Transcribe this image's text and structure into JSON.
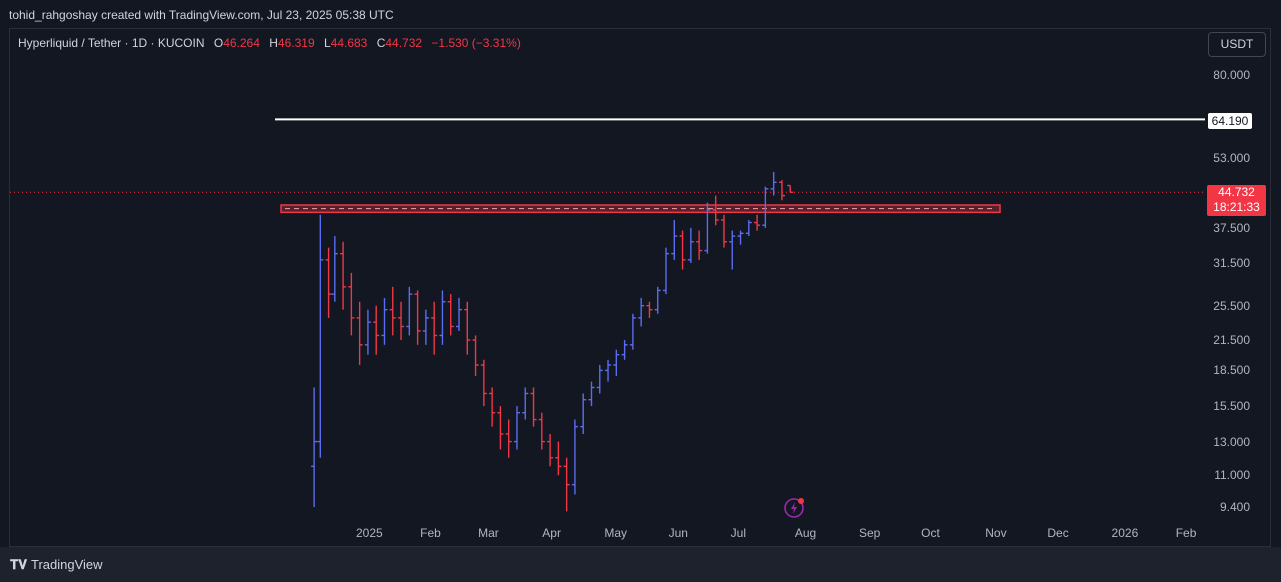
{
  "header": {
    "attribution": "tohid_rahgoshay created with TradingView.com, Jul 23, 2025 05:38 UTC"
  },
  "legend": {
    "symbol": "Hyperliquid / Tether · 1D · KUCOIN",
    "o_label": "O",
    "o_value": "46.264",
    "h_label": "H",
    "h_value": "46.319",
    "l_label": "L",
    "l_value": "44.683",
    "c_label": "C",
    "c_value": "44.732",
    "change": "−1.530 (−3.31%)"
  },
  "currency_button": "USDT",
  "price_axis": [
    "80.000",
    "53.000",
    "37.500",
    "31.500",
    "25.500",
    "21.500",
    "18.500",
    "15.500",
    "13.000",
    "11.000",
    "9.400"
  ],
  "time_axis": [
    "2025",
    "Feb",
    "Mar",
    "Apr",
    "May",
    "Jun",
    "Jul",
    "Aug",
    "Sep",
    "Oct",
    "Nov",
    "Dec",
    "2026",
    "Feb"
  ],
  "level_line": {
    "label": "64.190"
  },
  "last_price": {
    "price": "44.732",
    "countdown": "18:21:33"
  },
  "footer": {
    "brand": "TradingView"
  },
  "colors": {
    "up": "#5b6cf0",
    "down": "#f23645",
    "zone": "#f23645",
    "level": "#ffffff",
    "background": "#131722"
  },
  "chart_data": {
    "type": "ohlc",
    "scale": "log",
    "y_ticks": [
      80,
      53,
      37.5,
      31.5,
      25.5,
      21.5,
      18.5,
      15.5,
      13,
      11,
      9.4
    ],
    "x_ticks": [
      "2025",
      "Feb",
      "Mar",
      "Apr",
      "May",
      "Jun",
      "Jul",
      "Aug",
      "Sep",
      "Oct",
      "Nov",
      "Dec",
      "2026",
      "Feb"
    ],
    "horizontal_level": 64.19,
    "support_zone": {
      "low": 40.5,
      "high": 42.0,
      "from": "2024-12-22",
      "to": "2025-11-15"
    },
    "last_close": 44.732,
    "series": [
      {
        "t": "2024-12-05",
        "o": 11.5,
        "h": 17.0,
        "l": 9.4,
        "c": 13.0
      },
      {
        "t": "2024-12-08",
        "o": 13.0,
        "h": 40.0,
        "l": 12.0,
        "c": 32.0
      },
      {
        "t": "2024-12-12",
        "o": 32.0,
        "h": 34.0,
        "l": 24.0,
        "c": 27.0
      },
      {
        "t": "2024-12-15",
        "o": 27.0,
        "h": 36.0,
        "l": 26.0,
        "c": 33.0
      },
      {
        "t": "2024-12-19",
        "o": 33.0,
        "h": 35.0,
        "l": 25.0,
        "c": 28.0
      },
      {
        "t": "2024-12-23",
        "o": 28.0,
        "h": 30.0,
        "l": 22.0,
        "c": 24.0
      },
      {
        "t": "2024-12-27",
        "o": 24.0,
        "h": 26.0,
        "l": 19.0,
        "c": 21.0
      },
      {
        "t": "2024-12-31",
        "o": 21.0,
        "h": 25.0,
        "l": 20.0,
        "c": 23.5
      },
      {
        "t": "2025-01-04",
        "o": 23.5,
        "h": 25.5,
        "l": 20.0,
        "c": 22.0
      },
      {
        "t": "2025-01-08",
        "o": 22.0,
        "h": 26.5,
        "l": 21.0,
        "c": 25.0
      },
      {
        "t": "2025-01-12",
        "o": 25.0,
        "h": 28.0,
        "l": 22.0,
        "c": 24.0
      },
      {
        "t": "2025-01-16",
        "o": 24.0,
        "h": 26.0,
        "l": 21.5,
        "c": 23.0
      },
      {
        "t": "2025-01-20",
        "o": 23.0,
        "h": 28.0,
        "l": 22.0,
        "c": 27.0
      },
      {
        "t": "2025-01-24",
        "o": 27.0,
        "h": 27.5,
        "l": 21.0,
        "c": 22.5
      },
      {
        "t": "2025-01-28",
        "o": 22.5,
        "h": 25.0,
        "l": 21.0,
        "c": 24.0
      },
      {
        "t": "2025-02-01",
        "o": 24.0,
        "h": 26.0,
        "l": 20.0,
        "c": 22.0
      },
      {
        "t": "2025-02-05",
        "o": 22.0,
        "h": 27.5,
        "l": 21.0,
        "c": 26.0
      },
      {
        "t": "2025-02-09",
        "o": 26.0,
        "h": 27.0,
        "l": 22.0,
        "c": 23.0
      },
      {
        "t": "2025-02-13",
        "o": 23.0,
        "h": 26.5,
        "l": 22.5,
        "c": 25.0
      },
      {
        "t": "2025-02-17",
        "o": 25.0,
        "h": 26.0,
        "l": 20.0,
        "c": 21.5
      },
      {
        "t": "2025-02-21",
        "o": 21.5,
        "h": 22.0,
        "l": 18.0,
        "c": 19.0
      },
      {
        "t": "2025-02-25",
        "o": 19.0,
        "h": 19.5,
        "l": 15.5,
        "c": 16.5
      },
      {
        "t": "2025-03-01",
        "o": 16.5,
        "h": 17.0,
        "l": 14.0,
        "c": 15.0
      },
      {
        "t": "2025-03-05",
        "o": 15.0,
        "h": 15.5,
        "l": 12.5,
        "c": 13.5
      },
      {
        "t": "2025-03-09",
        "o": 13.5,
        "h": 14.5,
        "l": 12.0,
        "c": 13.0
      },
      {
        "t": "2025-03-13",
        "o": 13.0,
        "h": 15.5,
        "l": 12.5,
        "c": 15.0
      },
      {
        "t": "2025-03-17",
        "o": 15.0,
        "h": 17.0,
        "l": 14.5,
        "c": 16.5
      },
      {
        "t": "2025-03-21",
        "o": 16.5,
        "h": 17.0,
        "l": 14.0,
        "c": 14.5
      },
      {
        "t": "2025-03-25",
        "o": 14.5,
        "h": 15.0,
        "l": 12.5,
        "c": 13.0
      },
      {
        "t": "2025-03-29",
        "o": 13.0,
        "h": 13.5,
        "l": 11.5,
        "c": 12.0
      },
      {
        "t": "2025-04-02",
        "o": 12.0,
        "h": 13.0,
        "l": 11.0,
        "c": 11.5
      },
      {
        "t": "2025-04-06",
        "o": 11.5,
        "h": 12.0,
        "l": 9.2,
        "c": 10.5
      },
      {
        "t": "2025-04-10",
        "o": 10.5,
        "h": 14.5,
        "l": 10.0,
        "c": 14.0
      },
      {
        "t": "2025-04-14",
        "o": 14.0,
        "h": 16.5,
        "l": 13.5,
        "c": 16.0
      },
      {
        "t": "2025-04-18",
        "o": 16.0,
        "h": 17.5,
        "l": 15.5,
        "c": 17.0
      },
      {
        "t": "2025-04-22",
        "o": 17.0,
        "h": 19.0,
        "l": 16.5,
        "c": 18.5
      },
      {
        "t": "2025-04-26",
        "o": 18.5,
        "h": 19.5,
        "l": 17.5,
        "c": 19.0
      },
      {
        "t": "2025-04-30",
        "o": 19.0,
        "h": 20.5,
        "l": 18.0,
        "c": 20.0
      },
      {
        "t": "2025-05-04",
        "o": 20.0,
        "h": 21.5,
        "l": 19.5,
        "c": 21.0
      },
      {
        "t": "2025-05-08",
        "o": 21.0,
        "h": 24.5,
        "l": 20.5,
        "c": 24.0
      },
      {
        "t": "2025-05-12",
        "o": 24.0,
        "h": 26.5,
        "l": 23.0,
        "c": 25.5
      },
      {
        "t": "2025-05-16",
        "o": 25.5,
        "h": 26.0,
        "l": 24.0,
        "c": 25.0
      },
      {
        "t": "2025-05-20",
        "o": 25.0,
        "h": 28.0,
        "l": 24.5,
        "c": 27.5
      },
      {
        "t": "2025-05-24",
        "o": 27.5,
        "h": 34.0,
        "l": 27.0,
        "c": 33.0
      },
      {
        "t": "2025-05-28",
        "o": 33.0,
        "h": 39.0,
        "l": 32.0,
        "c": 36.0
      },
      {
        "t": "2025-06-01",
        "o": 36.0,
        "h": 37.0,
        "l": 30.5,
        "c": 32.0
      },
      {
        "t": "2025-06-05",
        "o": 32.0,
        "h": 37.5,
        "l": 31.5,
        "c": 35.0
      },
      {
        "t": "2025-06-09",
        "o": 35.0,
        "h": 37.0,
        "l": 32.0,
        "c": 33.5
      },
      {
        "t": "2025-06-13",
        "o": 33.5,
        "h": 42.5,
        "l": 33.0,
        "c": 41.0
      },
      {
        "t": "2025-06-17",
        "o": 41.0,
        "h": 44.0,
        "l": 38.0,
        "c": 39.0
      },
      {
        "t": "2025-06-21",
        "o": 39.0,
        "h": 40.0,
        "l": 34.0,
        "c": 35.0
      },
      {
        "t": "2025-06-25",
        "o": 35.0,
        "h": 37.0,
        "l": 30.5,
        "c": 36.0
      },
      {
        "t": "2025-06-29",
        "o": 36.0,
        "h": 37.0,
        "l": 34.5,
        "c": 36.5
      },
      {
        "t": "2025-07-03",
        "o": 36.5,
        "h": 39.0,
        "l": 36.0,
        "c": 38.5
      },
      {
        "t": "2025-07-07",
        "o": 38.5,
        "h": 40.0,
        "l": 37.0,
        "c": 38.0
      },
      {
        "t": "2025-07-11",
        "o": 38.0,
        "h": 46.0,
        "l": 37.5,
        "c": 45.5
      },
      {
        "t": "2025-07-15",
        "o": 45.5,
        "h": 49.5,
        "l": 44.0,
        "c": 47.0
      },
      {
        "t": "2025-07-19",
        "o": 47.0,
        "h": 47.5,
        "l": 43.0,
        "c": 44.0
      },
      {
        "t": "2025-07-23",
        "o": 46.264,
        "h": 46.319,
        "l": 44.683,
        "c": 44.732
      }
    ]
  }
}
